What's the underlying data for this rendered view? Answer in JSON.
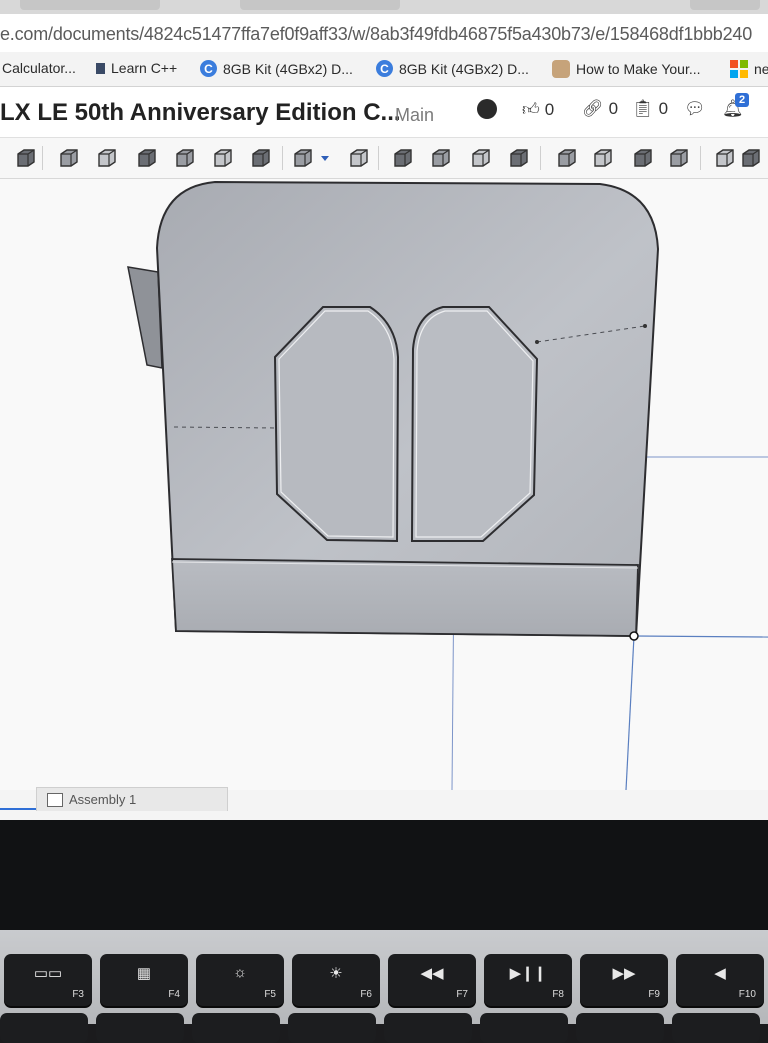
{
  "browser": {
    "url": "e.com/documents/4824c51477ffa7ef0f9aff33/w/8ab3f49fdb46875f5a430b73/e/158468df1bbb240",
    "bookmarks": [
      {
        "label": "Calculator...",
        "icon": "none"
      },
      {
        "label": "Learn C++",
        "icon": "doc-icon"
      },
      {
        "label": "8GB Kit (4GBx2) D...",
        "icon": "c-logo-icon"
      },
      {
        "label": "8GB Kit (4GBx2) D...",
        "icon": "c-logo-icon"
      },
      {
        "label": "How to Make Your...",
        "icon": "hand-icon"
      },
      {
        "label": "ne",
        "icon": "microsoft-icon"
      }
    ]
  },
  "document": {
    "title": "LX LE 50th Anniversary Edition C...",
    "branch": "Main",
    "likes": "0",
    "links": "0",
    "copies": "0",
    "notifications": "2"
  },
  "toolbar": {
    "tools": [
      "sketch-icon",
      "extrude-icon",
      "revolve-icon",
      "sweep-icon",
      "loft-icon",
      "thicken-icon",
      "fillet-icon",
      "pattern-icon",
      "mirror-icon",
      "boolean-icon",
      "split-icon",
      "transform-icon",
      "delete-part-icon",
      "move-face-icon",
      "delete-face-icon",
      "replace-face-icon",
      "offset-surface-icon",
      "sheet-metal-icon",
      "plane-icon"
    ]
  },
  "tabs": {
    "assembly": "Assembly 1"
  },
  "keyboard": {
    "keys": [
      {
        "label": "F3",
        "sym": "▭▭"
      },
      {
        "label": "F4",
        "sym": "▦"
      },
      {
        "label": "F5",
        "sym": "☼"
      },
      {
        "label": "F6",
        "sym": "☀"
      },
      {
        "label": "F7",
        "sym": "◀◀"
      },
      {
        "label": "F8",
        "sym": "▶❙❙"
      },
      {
        "label": "F9",
        "sym": "▶▶"
      },
      {
        "label": "F10",
        "sym": "◀"
      }
    ]
  },
  "colors": {
    "part_fill": "#b3b6bc",
    "part_edge": "#2d2d30",
    "selection_blue": "#5a7fc0"
  }
}
